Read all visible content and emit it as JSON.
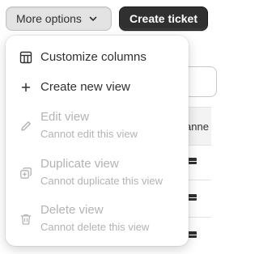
{
  "toolbar": {
    "more_options_label": "More options",
    "create_ticket_label": "Create ticket"
  },
  "background": {
    "column_header_partial": "anne"
  },
  "menu": {
    "customize_columns": {
      "label": "Customize columns",
      "icon": "table-icon"
    },
    "create_new_view": {
      "label": "Create new view",
      "icon": "plus-icon"
    },
    "edit_view": {
      "label": "Edit view",
      "sub": "Cannot edit this view",
      "icon": "pencil-icon",
      "disabled": true
    },
    "duplicate_view": {
      "label": "Duplicate view",
      "sub": "Cannot duplicate this view",
      "icon": "duplicate-icon",
      "disabled": true
    },
    "delete_view": {
      "label": "Delete view",
      "sub": "Cannot delete this view",
      "icon": "trash-icon",
      "disabled": true
    }
  },
  "colors": {
    "primary_button": "#303030",
    "secondary_button": "#e3e3e3",
    "text": "#303030",
    "disabled_text": "#b3b3b3"
  }
}
